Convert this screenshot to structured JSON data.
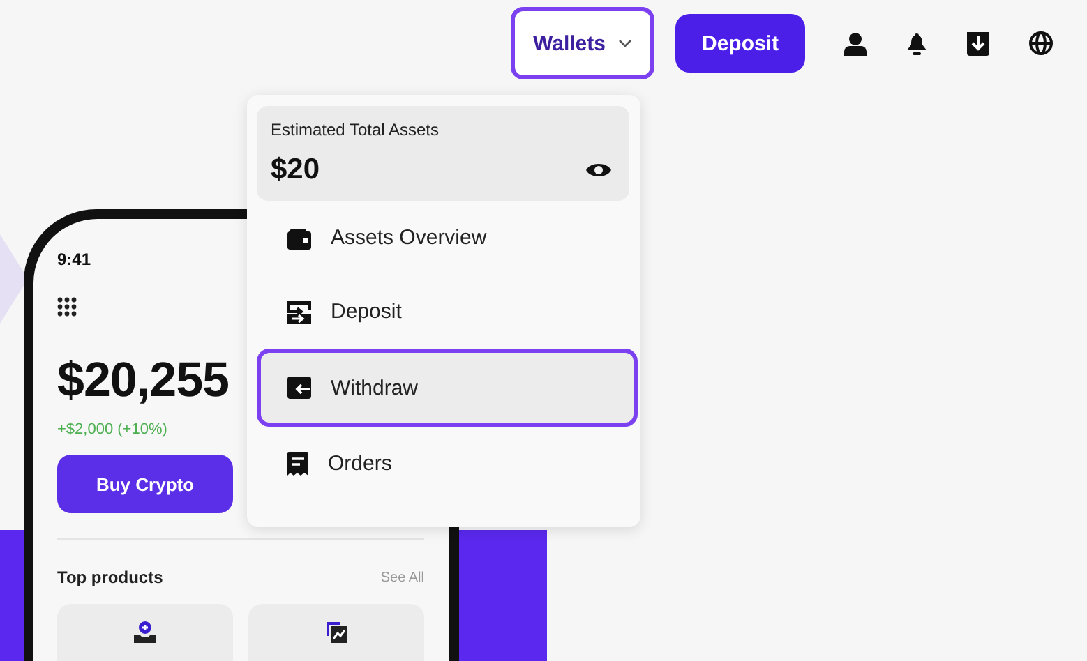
{
  "header": {
    "wallets": {
      "label": "Wallets",
      "selected": true
    },
    "deposit": "Deposit"
  },
  "menu": {
    "summary": {
      "label": "Estimated Total Assets",
      "value": "$20"
    },
    "items": [
      {
        "label": "Assets Overview",
        "kind": "wallet",
        "selected": false
      },
      {
        "label": "Deposit",
        "kind": "deposit",
        "selected": false
      },
      {
        "label": "Withdraw",
        "kind": "withdraw",
        "selected": true
      },
      {
        "label": "Orders",
        "kind": "receipt",
        "selected": false
      }
    ]
  },
  "phone": {
    "time": "9:41",
    "balance": "$20,255",
    "change": "+$2,000 (+10%)",
    "button": "Buy Crypto",
    "section": "Top products",
    "link": "See All"
  }
}
